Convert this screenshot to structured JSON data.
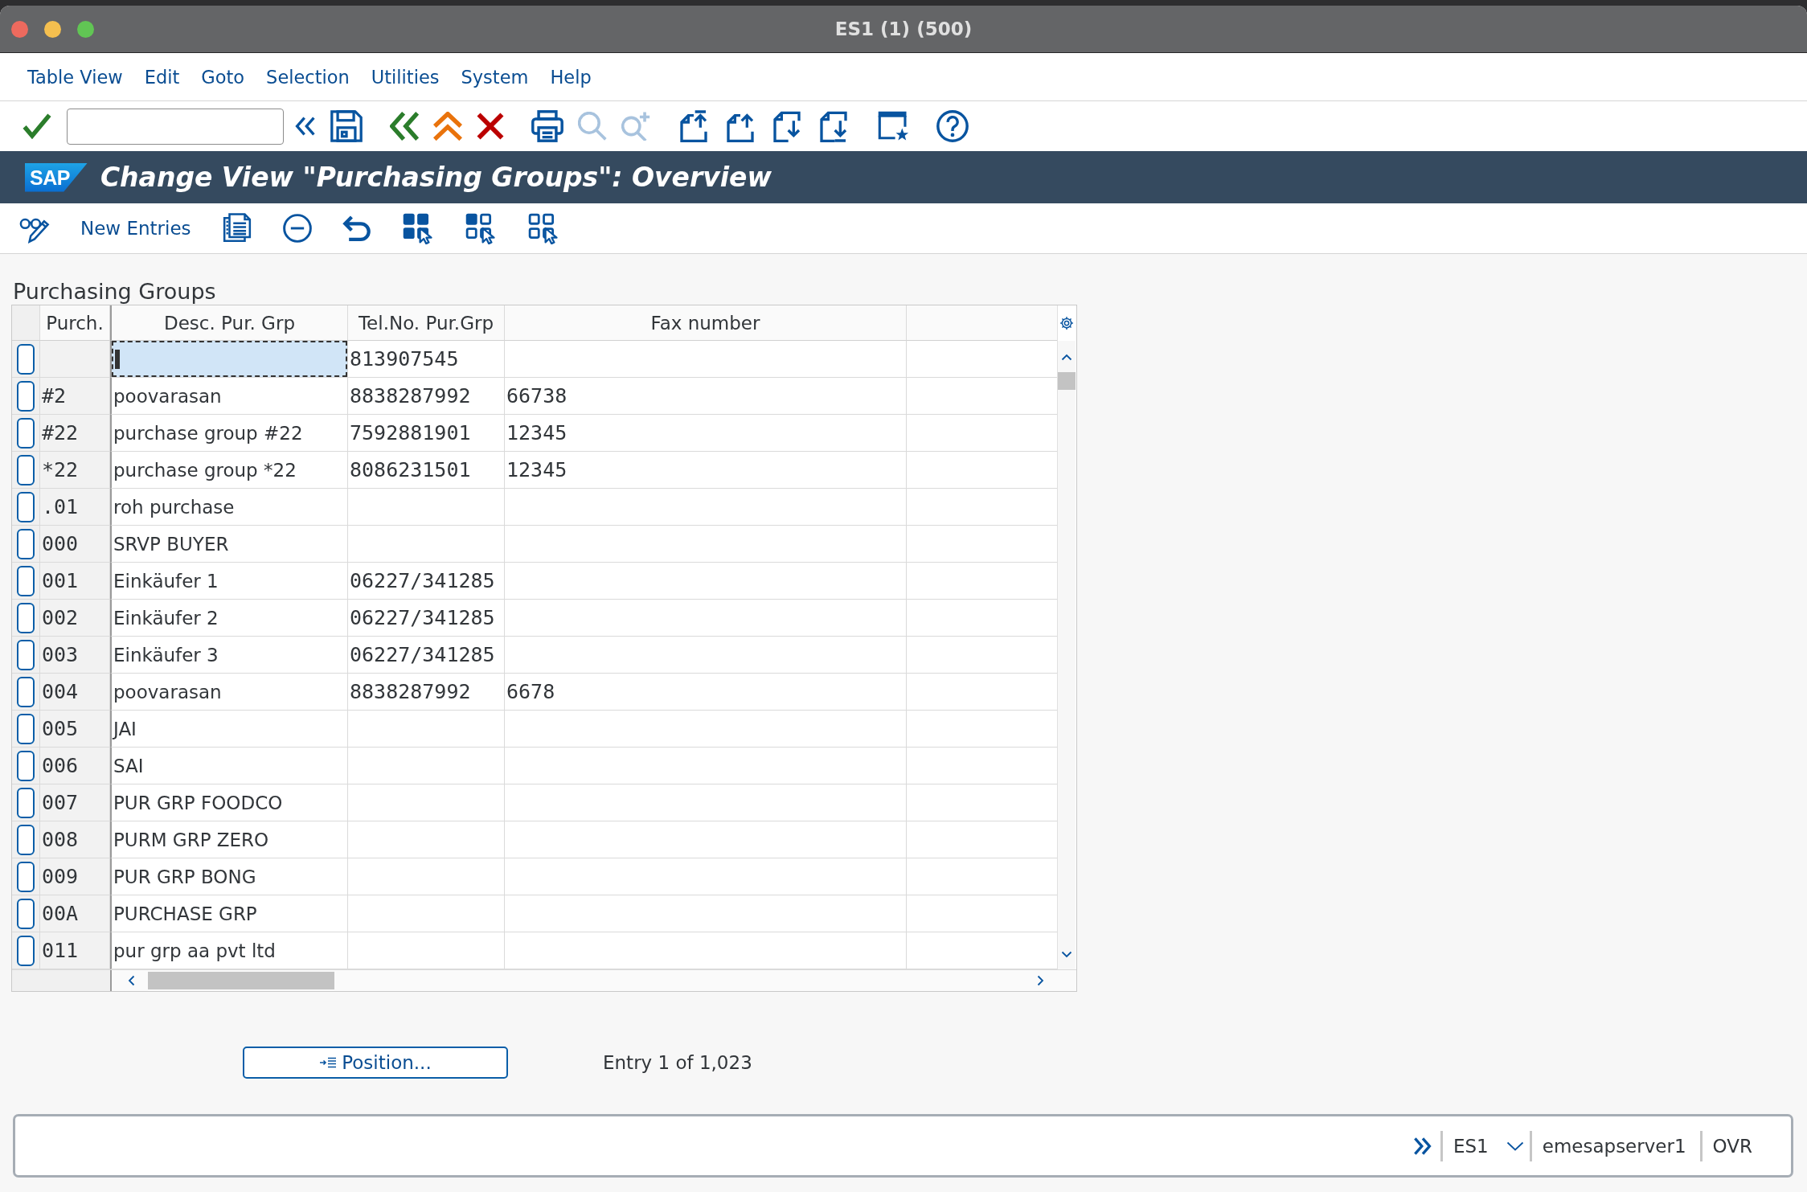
{
  "window": {
    "title": "ES1 (1) (500)"
  },
  "menu_bar": {
    "items": [
      "Table View",
      "Edit",
      "Goto",
      "Selection",
      "Utilities",
      "System",
      "Help"
    ]
  },
  "system_toolbar": {
    "items": [
      {
        "kind": "enter",
        "disabled": false
      },
      {
        "kind": "command",
        "disabled": false
      },
      {
        "kind": "collapse",
        "disabled": false
      },
      {
        "kind": "save",
        "disabled": false
      },
      {
        "kind": "back",
        "disabled": false
      },
      {
        "kind": "exit",
        "disabled": false
      },
      {
        "kind": "cancel",
        "disabled": false
      },
      {
        "kind": "print",
        "disabled": false
      },
      {
        "kind": "find",
        "disabled": true
      },
      {
        "kind": "findnext",
        "disabled": true
      },
      {
        "kind": "firstpage",
        "disabled": false
      },
      {
        "kind": "prevpage",
        "disabled": false
      },
      {
        "kind": "nextpage",
        "disabled": false
      },
      {
        "kind": "lastpage",
        "disabled": false
      },
      {
        "kind": "session",
        "disabled": false
      },
      {
        "kind": "help",
        "disabled": false
      }
    ]
  },
  "header": {
    "logo": "SAP",
    "title": "Change View \"Purchasing Groups\": Overview"
  },
  "app_toolbar": {
    "items": [
      {
        "kind": "toggle"
      },
      {
        "kind": "text",
        "label": "New Entries"
      },
      {
        "kind": "copy"
      },
      {
        "kind": "delete"
      },
      {
        "kind": "undo"
      },
      {
        "kind": "selectall"
      },
      {
        "kind": "selectblock"
      },
      {
        "kind": "deselect"
      }
    ]
  },
  "table": {
    "title": "Purchasing Groups",
    "columns": [
      "Purch.",
      "Desc. Pur. Grp",
      "Tel.No. Pur.Grp",
      "Fax number"
    ],
    "rows": [
      {
        "tel": "813907545",
        "selected": false,
        "focused": true
      },
      {
        "purch": "#2",
        "desc": "poovarasan",
        "tel": "8838287992",
        "fax": "66738",
        "selected": false,
        "focused": false
      },
      {
        "purch": "#22",
        "desc": "purchase group #22",
        "tel": "7592881901",
        "fax": "12345",
        "selected": false,
        "focused": false
      },
      {
        "purch": "*22",
        "desc": "purchase group *22",
        "tel": "8086231501",
        "fax": "12345",
        "selected": false,
        "focused": false
      },
      {
        "purch": ".01",
        "desc": "roh purchase",
        "selected": false,
        "focused": false
      },
      {
        "purch": "000",
        "desc": "SRVP BUYER",
        "selected": false,
        "focused": false
      },
      {
        "purch": "001",
        "desc": "Einkäufer 1",
        "tel": "06227/341285",
        "selected": false,
        "focused": false
      },
      {
        "purch": "002",
        "desc": "Einkäufer 2",
        "tel": "06227/341285",
        "selected": false,
        "focused": false
      },
      {
        "purch": "003",
        "desc": "Einkäufer 3",
        "tel": "06227/341285",
        "selected": false,
        "focused": false
      },
      {
        "purch": "004",
        "desc": "poovarasan",
        "tel": "8838287992",
        "fax": "6678",
        "selected": false,
        "focused": false
      },
      {
        "purch": "005",
        "desc": "JAI",
        "selected": false,
        "focused": false
      },
      {
        "purch": "006",
        "desc": "SAI",
        "selected": false,
        "focused": false
      },
      {
        "purch": "007",
        "desc": "PUR GRP FOODCO",
        "selected": false,
        "focused": false
      },
      {
        "purch": "008",
        "desc": "PURM GRP ZERO",
        "selected": false,
        "focused": false
      },
      {
        "purch": "009",
        "desc": "PUR GRP BONG",
        "selected": false,
        "focused": false
      },
      {
        "purch": "00A",
        "desc": "PURCHASE GRP",
        "selected": false,
        "focused": false
      },
      {
        "purch": "011",
        "desc": "pur grp aa pvt ltd",
        "selected": false,
        "focused": false
      }
    ]
  },
  "position_button": {
    "label": "Position..."
  },
  "entry_count": "Entry 1 of 1,023",
  "status_bar": {
    "system": "ES1",
    "server": "emesapserver1",
    "mode": "OVR"
  }
}
